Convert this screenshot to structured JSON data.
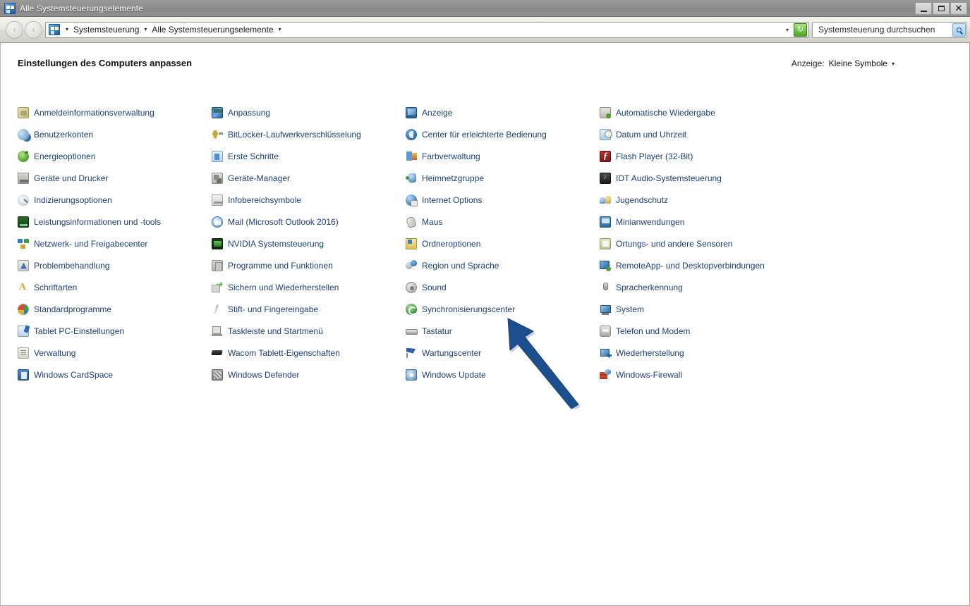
{
  "window": {
    "title": "Alle Systemsteuerungselemente",
    "title_icon": "control-panel-icon",
    "minimize_label": "–",
    "maximize_label": "□",
    "close_label": "✕"
  },
  "navbar": {
    "back_label": "‹",
    "forward_label": "›",
    "breadcrumb": [
      {
        "label": "Systemsteuerung"
      },
      {
        "label": "Alle Systemsteuerungselemente"
      }
    ],
    "separator": "▸",
    "dropdown_caret": "▾",
    "refresh_icon": "refresh-icon",
    "refresh_label": "↻",
    "search": {
      "placeholder": "Systemsteuerung durchsuchen",
      "value": "",
      "icon": "search-icon"
    }
  },
  "content": {
    "page_title": "Einstellungen des Computers anpassen",
    "view": {
      "label": "Anzeige:",
      "value": "Kleine Symbole",
      "caret": "▾"
    }
  },
  "colors": {
    "link": "#1c3f7a",
    "titlebar": "#8f8f8f",
    "arrow": "#1d4f8f",
    "content_bg": "#ffffff"
  },
  "overlay": {
    "arrow": {
      "name": "annotation-arrow",
      "color": "#1d4f8f",
      "points_to": "Region und Sprache"
    }
  },
  "items": [
    {
      "label": "Anmeldeinformationsverwaltung",
      "icon": "credential-manager-icon",
      "icon_class": "ico-credential",
      "col": 0
    },
    {
      "label": "Benutzerkonten",
      "icon": "user-accounts-icon",
      "icon_class": "ico-users",
      "col": 0
    },
    {
      "label": "Energieoptionen",
      "icon": "power-options-icon",
      "icon_class": "ico-power",
      "col": 0
    },
    {
      "label": "Geräte und Drucker",
      "icon": "devices-printers-icon",
      "icon_class": "ico-devices",
      "col": 0
    },
    {
      "label": "Indizierungsoptionen",
      "icon": "indexing-options-icon",
      "icon_class": "ico-index",
      "col": 0
    },
    {
      "label": "Leistungsinformationen und -tools",
      "icon": "performance-info-icon",
      "icon_class": "ico-perf",
      "col": 0
    },
    {
      "label": "Netzwerk- und Freigabecenter",
      "icon": "network-sharing-icon",
      "icon_class": "ico-network",
      "col": 0
    },
    {
      "label": "Problembehandlung",
      "icon": "troubleshooting-icon",
      "icon_class": "ico-trouble",
      "col": 0
    },
    {
      "label": "Schriftarten",
      "icon": "fonts-icon",
      "icon_class": "ico-fonts",
      "col": 0
    },
    {
      "label": "Standardprogramme",
      "icon": "default-programs-icon",
      "icon_class": "ico-default",
      "col": 0
    },
    {
      "label": "Tablet PC-Einstellungen",
      "icon": "tablet-pc-settings-icon",
      "icon_class": "ico-tablet",
      "col": 0
    },
    {
      "label": "Verwaltung",
      "icon": "administrative-tools-icon",
      "icon_class": "ico-admin",
      "col": 0
    },
    {
      "label": "Windows CardSpace",
      "icon": "cardspace-icon",
      "icon_class": "ico-cardspace",
      "col": 0
    },
    {
      "label": "Anpassung",
      "icon": "personalization-icon",
      "icon_class": "ico-person",
      "col": 1
    },
    {
      "label": "BitLocker-Laufwerkverschlüsselung",
      "icon": "bitlocker-icon",
      "icon_class": "ico-bitlocker",
      "col": 1
    },
    {
      "label": "Erste Schritte",
      "icon": "getting-started-icon",
      "icon_class": "ico-getstarted",
      "col": 1
    },
    {
      "label": "Geräte-Manager",
      "icon": "device-manager-icon",
      "icon_class": "ico-devmgr",
      "col": 1
    },
    {
      "label": "Infobereichsymbole",
      "icon": "notification-area-icons-icon",
      "icon_class": "ico-notifyarea",
      "col": 1
    },
    {
      "label": "Mail (Microsoft Outlook 2016)",
      "icon": "mail-icon",
      "icon_class": "ico-mail",
      "col": 1
    },
    {
      "label": "NVIDIA Systemsteuerung",
      "icon": "nvidia-control-panel-icon",
      "icon_class": "ico-nvidia",
      "col": 1
    },
    {
      "label": "Programme und Funktionen",
      "icon": "programs-features-icon",
      "icon_class": "ico-programs",
      "col": 1
    },
    {
      "label": "Sichern und Wiederherstellen",
      "icon": "backup-restore-icon",
      "icon_class": "ico-backup",
      "col": 1
    },
    {
      "label": "Stift- und Fingereingabe",
      "icon": "pen-touch-icon",
      "icon_class": "ico-pen",
      "col": 1
    },
    {
      "label": "Taskleiste und Startmenü",
      "icon": "taskbar-startmenu-icon",
      "icon_class": "ico-taskbar",
      "col": 1
    },
    {
      "label": "Wacom Tablett-Eigenschaften",
      "icon": "wacom-tablet-icon",
      "icon_class": "ico-wacom",
      "col": 1
    },
    {
      "label": "Windows Defender",
      "icon": "windows-defender-icon",
      "icon_class": "ico-defender",
      "col": 1
    },
    {
      "label": "Anzeige",
      "icon": "display-icon",
      "icon_class": "ico-display",
      "col": 2
    },
    {
      "label": "Center für erleichterte Bedienung",
      "icon": "ease-of-access-icon",
      "icon_class": "ico-ease",
      "col": 2
    },
    {
      "label": "Farbverwaltung",
      "icon": "color-management-icon",
      "icon_class": "ico-color",
      "col": 2
    },
    {
      "label": "Heimnetzgruppe",
      "icon": "homegroup-icon",
      "icon_class": "ico-homegroup",
      "col": 2
    },
    {
      "label": "Internet Options",
      "icon": "internet-options-icon",
      "icon_class": "ico-internet",
      "col": 2
    },
    {
      "label": "Maus",
      "icon": "mouse-icon",
      "icon_class": "ico-mouse",
      "col": 2
    },
    {
      "label": "Ordneroptionen",
      "icon": "folder-options-icon",
      "icon_class": "ico-folderopt",
      "col": 2
    },
    {
      "label": "Region und Sprache",
      "icon": "region-language-icon",
      "icon_class": "ico-region",
      "col": 2
    },
    {
      "label": "Sound",
      "icon": "sound-icon",
      "icon_class": "ico-sound",
      "col": 2
    },
    {
      "label": "Synchronisierungscenter",
      "icon": "sync-center-icon",
      "icon_class": "ico-sync",
      "col": 2
    },
    {
      "label": "Tastatur",
      "icon": "keyboard-icon",
      "icon_class": "ico-keyboard",
      "col": 2
    },
    {
      "label": "Wartungscenter",
      "icon": "action-center-icon",
      "icon_class": "ico-maint",
      "col": 2
    },
    {
      "label": "Windows Update",
      "icon": "windows-update-icon",
      "icon_class": "ico-wupdate",
      "col": 2
    },
    {
      "label": "Automatische Wiedergabe",
      "icon": "autoplay-icon",
      "icon_class": "ico-autoplay",
      "col": 3
    },
    {
      "label": "Datum und Uhrzeit",
      "icon": "date-time-icon",
      "icon_class": "ico-datetime",
      "col": 3
    },
    {
      "label": "Flash Player (32-Bit)",
      "icon": "flash-player-icon",
      "icon_class": "ico-flash",
      "col": 3
    },
    {
      "label": "IDT Audio-Systemsteuerung",
      "icon": "idt-audio-icon",
      "icon_class": "ico-idt",
      "col": 3
    },
    {
      "label": "Jugendschutz",
      "icon": "parental-controls-icon",
      "icon_class": "ico-parental",
      "col": 3
    },
    {
      "label": "Minianwendungen",
      "icon": "desktop-gadgets-icon",
      "icon_class": "ico-gadgets",
      "col": 3
    },
    {
      "label": "Ortungs- und andere Sensoren",
      "icon": "location-sensors-icon",
      "icon_class": "ico-sensors",
      "col": 3
    },
    {
      "label": "RemoteApp- und Desktopverbindungen",
      "icon": "remoteapp-icon",
      "icon_class": "ico-remoteapp",
      "col": 3
    },
    {
      "label": "Spracherkennung",
      "icon": "speech-recognition-icon",
      "icon_class": "ico-speech",
      "col": 3
    },
    {
      "label": "System",
      "icon": "system-icon",
      "icon_class": "ico-system",
      "col": 3
    },
    {
      "label": "Telefon und Modem",
      "icon": "phone-modem-icon",
      "icon_class": "ico-phone",
      "col": 3
    },
    {
      "label": "Wiederherstellung",
      "icon": "recovery-icon",
      "icon_class": "ico-recovery",
      "col": 3
    },
    {
      "label": "Windows-Firewall",
      "icon": "windows-firewall-icon",
      "icon_class": "ico-firewall",
      "col": 3
    }
  ]
}
